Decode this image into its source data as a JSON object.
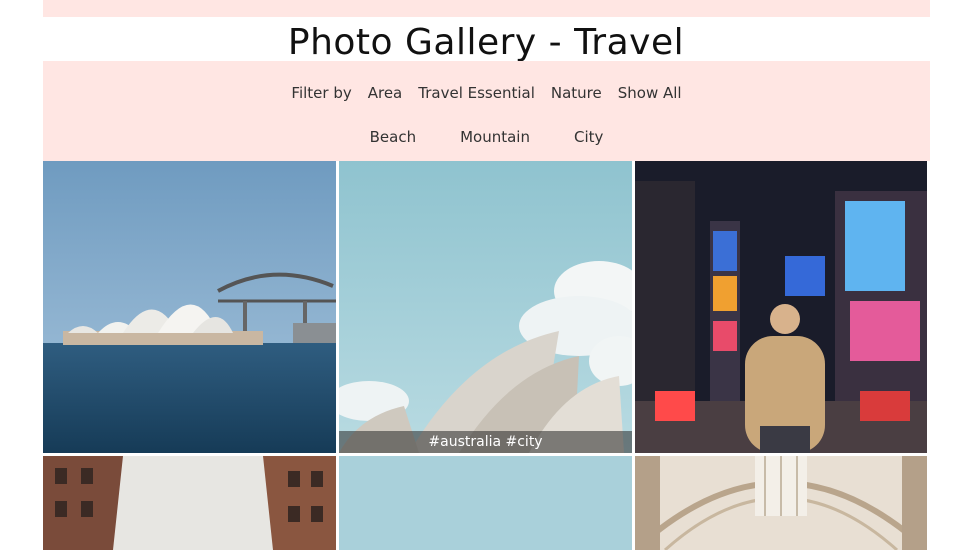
{
  "page": {
    "title": "Photo Gallery - Travel"
  },
  "nav": {
    "filter_label": "Filter by",
    "categories": [
      "Area",
      "Travel Essential",
      "Nature",
      "Show All"
    ],
    "subcategories": [
      "Beach",
      "Mountain",
      "City"
    ]
  },
  "gallery": {
    "hovered_caption": "#australia #city",
    "photos": [
      {
        "subject": "sydney-opera-house-harbour"
      },
      {
        "subject": "opera-house-closeup"
      },
      {
        "subject": "times-square-night"
      },
      {
        "subject": "brick-buildings"
      },
      {
        "subject": "sky"
      },
      {
        "subject": "glass-arcade"
      }
    ]
  },
  "colors": {
    "nav_background": "#ffe6e3",
    "page_background": "#ffffff"
  }
}
